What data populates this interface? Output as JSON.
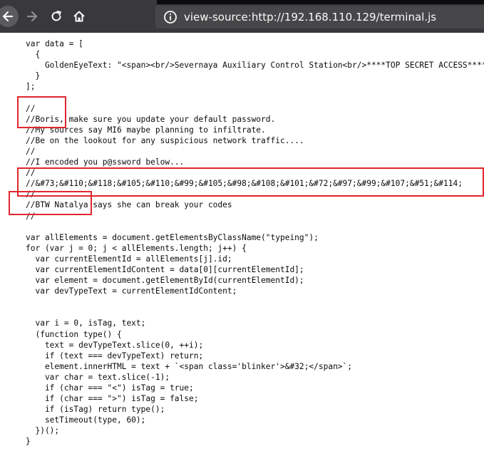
{
  "browser": {
    "url": "view-source:http://192.168.110.129/terminal.js"
  },
  "icons": [
    "back-arrow-icon",
    "forward-arrow-icon",
    "reload-icon",
    "home-icon",
    "info-icon"
  ],
  "colors": {
    "toolbar": "#38383d",
    "urlbar": "#474749",
    "highlight": "#e0262e",
    "code_text": "#0c0c0d"
  },
  "source_lines": [
    "var data = [",
    "  {",
    "    GoldenEyeText: \"<span><br/>Severnaya Auxiliary Control Station<br/>****TOP SECRET ACCESS****<br/>Accessing Server Identity<br/>Server Name:....................<br/>GOLDENEYE<br/><br/>Network</span>\"",
    "  }",
    "];",
    "",
    "//",
    "//Boris, make sure you update your default password.",
    "//My sources say MI6 maybe planning to infiltrate.",
    "//Be on the lookout for any suspicious network traffic....",
    "//",
    "//I encoded you p@ssword below...",
    "//",
    "//&#73;&#110;&#118;&#105;&#110;&#99;&#105;&#98;&#108;&#101;&#72;&#97;&#99;&#107;&#51;&#114;",
    "//",
    "//BTW Natalya says she can break your codes",
    "//",
    "",
    "var allElements = document.getElementsByClassName(\"typeing\");",
    "for (var j = 0; j < allElements.length; j++) {",
    "  var currentElementId = allElements[j].id;",
    "  var currentElementIdContent = data[0][currentElementId];",
    "  var element = document.getElementById(currentElementId);",
    "  var devTypeText = currentElementIdContent;",
    "",
    "",
    "  var i = 0, isTag, text;",
    "  (function type() {",
    "    text = devTypeText.slice(0, ++i);",
    "    if (text === devTypeText) return;",
    "    element.innerHTML = text + `<span class='blinker'>&#32;</span>`;",
    "    var char = text.slice(-1);",
    "    if (char === \"<\") isTag = true;",
    "    if (char === \">\") isTag = false;",
    "    if (isTag) return type();",
    "    setTimeout(type, 60);",
    "  })();",
    "}"
  ]
}
